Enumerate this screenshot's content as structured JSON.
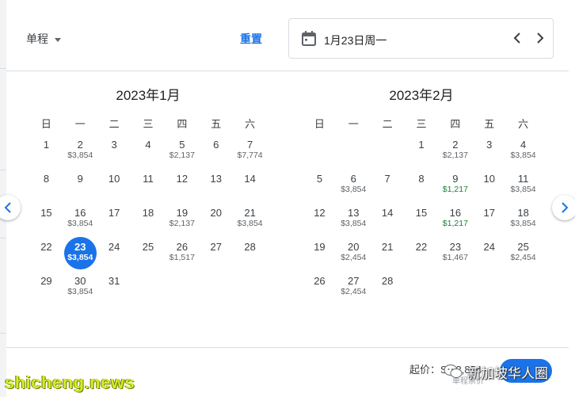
{
  "header": {
    "trip_type": "单程",
    "reset_label": "重置",
    "selected_date_text": "1月23日周一"
  },
  "calendar": {
    "weekday_labels": [
      "日",
      "一",
      "二",
      "三",
      "四",
      "五",
      "六"
    ],
    "months": [
      {
        "title": "2023年1月",
        "weeks": [
          [
            {
              "d": "1",
              "p": ""
            },
            {
              "d": "2",
              "p": "$3,854"
            },
            {
              "d": "3",
              "p": ""
            },
            {
              "d": "4",
              "p": ""
            },
            {
              "d": "5",
              "p": "$2,137"
            },
            {
              "d": "6",
              "p": ""
            },
            {
              "d": "7",
              "p": "$7,774"
            }
          ],
          [
            {
              "d": "8",
              "p": ""
            },
            {
              "d": "9",
              "p": ""
            },
            {
              "d": "10",
              "p": ""
            },
            {
              "d": "11",
              "p": ""
            },
            {
              "d": "12",
              "p": ""
            },
            {
              "d": "13",
              "p": ""
            },
            {
              "d": "14",
              "p": ""
            }
          ],
          [
            {
              "d": "15",
              "p": ""
            },
            {
              "d": "16",
              "p": "$3,854"
            },
            {
              "d": "17",
              "p": ""
            },
            {
              "d": "18",
              "p": ""
            },
            {
              "d": "19",
              "p": "$2,137"
            },
            {
              "d": "20",
              "p": ""
            },
            {
              "d": "21",
              "p": "$3,854"
            }
          ],
          [
            {
              "d": "22",
              "p": ""
            },
            {
              "d": "23",
              "p": "$3,854",
              "selected": true
            },
            {
              "d": "24",
              "p": ""
            },
            {
              "d": "25",
              "p": ""
            },
            {
              "d": "26",
              "p": "$1,517"
            },
            {
              "d": "27",
              "p": ""
            },
            {
              "d": "28",
              "p": ""
            }
          ],
          [
            {
              "d": "29",
              "p": ""
            },
            {
              "d": "30",
              "p": "$3,854"
            },
            {
              "d": "31",
              "p": ""
            },
            {
              "d": "",
              "p": ""
            },
            {
              "d": "",
              "p": ""
            },
            {
              "d": "",
              "p": ""
            },
            {
              "d": "",
              "p": ""
            }
          ]
        ]
      },
      {
        "title": "2023年2月",
        "weeks": [
          [
            {
              "d": "",
              "p": ""
            },
            {
              "d": "",
              "p": ""
            },
            {
              "d": "",
              "p": ""
            },
            {
              "d": "1",
              "p": ""
            },
            {
              "d": "2",
              "p": "$2,137"
            },
            {
              "d": "3",
              "p": ""
            },
            {
              "d": "4",
              "p": "$3,854"
            }
          ],
          [
            {
              "d": "5",
              "p": ""
            },
            {
              "d": "6",
              "p": "$3,854"
            },
            {
              "d": "7",
              "p": ""
            },
            {
              "d": "8",
              "p": ""
            },
            {
              "d": "9",
              "p": "$1,217",
              "low": true
            },
            {
              "d": "10",
              "p": ""
            },
            {
              "d": "11",
              "p": "$3,854"
            }
          ],
          [
            {
              "d": "12",
              "p": ""
            },
            {
              "d": "13",
              "p": "$3,854"
            },
            {
              "d": "14",
              "p": ""
            },
            {
              "d": "15",
              "p": ""
            },
            {
              "d": "16",
              "p": "$1,217",
              "low": true
            },
            {
              "d": "17",
              "p": ""
            },
            {
              "d": "18",
              "p": "$3,854"
            }
          ],
          [
            {
              "d": "19",
              "p": ""
            },
            {
              "d": "20",
              "p": "$2,454"
            },
            {
              "d": "21",
              "p": ""
            },
            {
              "d": "22",
              "p": ""
            },
            {
              "d": "23",
              "p": "$1,467"
            },
            {
              "d": "24",
              "p": ""
            },
            {
              "d": "25",
              "p": "$2,454"
            }
          ],
          [
            {
              "d": "26",
              "p": ""
            },
            {
              "d": "27",
              "p": "$2,454"
            },
            {
              "d": "28",
              "p": ""
            },
            {
              "d": "",
              "p": ""
            },
            {
              "d": "",
              "p": ""
            },
            {
              "d": "",
              "p": ""
            },
            {
              "d": "",
              "p": ""
            }
          ]
        ]
      }
    ]
  },
  "footer": {
    "from_price": "起价：S$ 3,854",
    "from_sub": "单程票价"
  },
  "watermarks": {
    "left": "shicheng.news",
    "right": "新加坡华人圈"
  },
  "colors": {
    "accent": "#1a73e8",
    "low_price": "#188038",
    "divider": "#dadce0"
  }
}
